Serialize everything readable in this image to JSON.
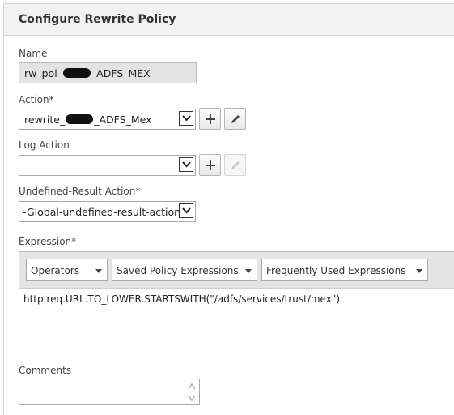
{
  "header": {
    "title": "Configure Rewrite Policy"
  },
  "name": {
    "label": "Name",
    "value_prefix": "rw_pol_",
    "value_suffix": "_ADFS_MEX"
  },
  "action": {
    "label": "Action*",
    "value_prefix": "rewrite_",
    "value_suffix": "_ADFS_Mex"
  },
  "log_action": {
    "label": "Log Action",
    "value": ""
  },
  "undefined_result": {
    "label": "Undefined-Result Action*",
    "value": "-Global-undefined-result-action-"
  },
  "expression": {
    "label": "Expression*",
    "toolbar": {
      "operators": "Operators",
      "saved": "Saved Policy Expressions",
      "frequent": "Frequently Used Expressions"
    },
    "value": "http.req.URL.TO_LOWER.STARTSWITH(\"/adfs/services/trust/mex\")"
  },
  "comments": {
    "label": "Comments",
    "value": ""
  },
  "icons": {
    "add": "plus-icon",
    "edit": "pencil-icon",
    "dropdown": "chevron-down-icon"
  }
}
